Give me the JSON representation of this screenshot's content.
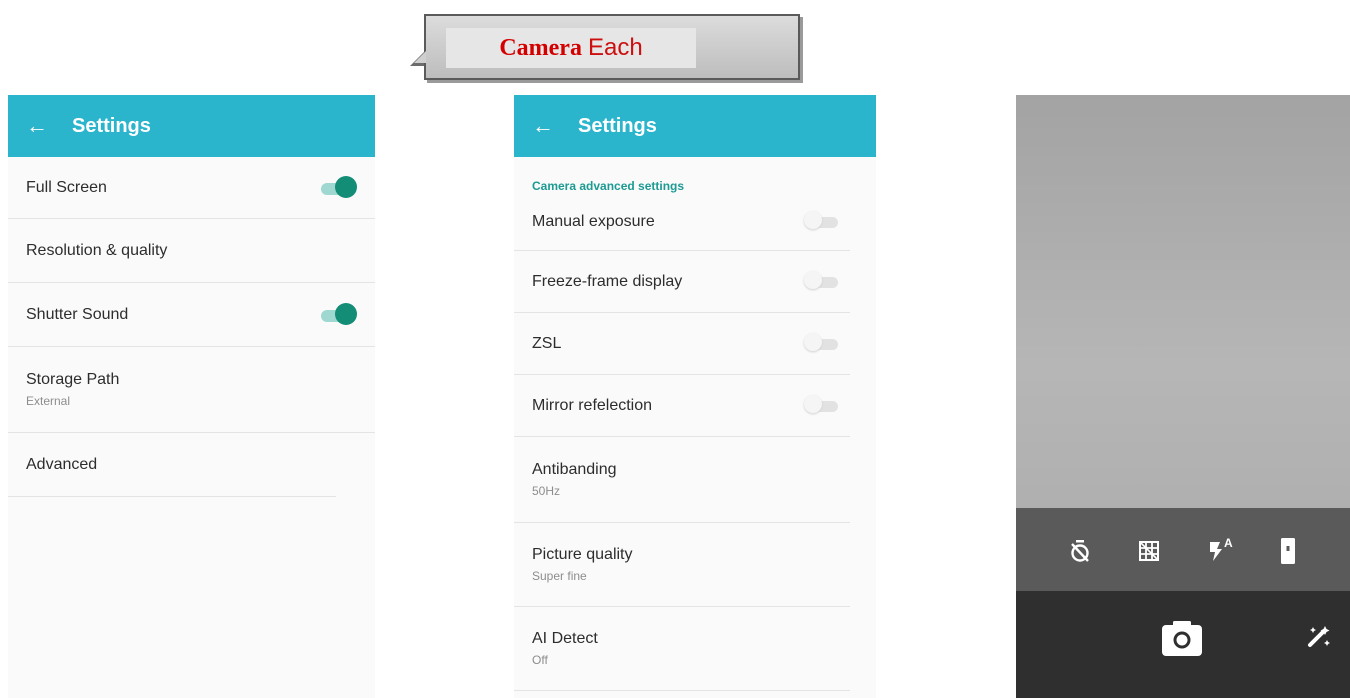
{
  "callout": {
    "strong": "Camera",
    "rest": "Each"
  },
  "screen1": {
    "title": "Settings",
    "items": [
      {
        "label": "Full Screen",
        "toggle": "on"
      },
      {
        "label": "Resolution & quality"
      },
      {
        "label": "Shutter Sound",
        "toggle": "on"
      },
      {
        "label": "Storage Path",
        "sub": "External"
      },
      {
        "label": "Advanced"
      }
    ]
  },
  "screen2": {
    "title": "Settings",
    "section": "Camera advanced settings",
    "items": [
      {
        "label": "Manual exposure",
        "toggle": "off"
      },
      {
        "label": "Freeze-frame display",
        "toggle": "off"
      },
      {
        "label": "ZSL",
        "toggle": "off"
      },
      {
        "label": "Mirror refelection",
        "toggle": "off"
      },
      {
        "label": "Antibanding",
        "sub": "50Hz"
      },
      {
        "label": "Picture quality",
        "sub": "Super fine"
      },
      {
        "label": "AI Detect",
        "sub": "Off"
      }
    ]
  },
  "camera": {
    "flash_mode": "A",
    "tool_icons": [
      "timer-off-icon",
      "grid-icon",
      "flash-auto-icon",
      "phone-orientation-icon"
    ],
    "bottom_icons": [
      "shutter-camera-icon",
      "magic-wand-icon"
    ],
    "colors": {
      "toolbar": "#5a5a5a",
      "bottom_bar": "#2f2f2f"
    }
  },
  "colors": {
    "appbar": "#2bb5cc",
    "toggle_on": "#148d77",
    "section_header": "#1c9a93",
    "callout_text": "#d40000"
  }
}
